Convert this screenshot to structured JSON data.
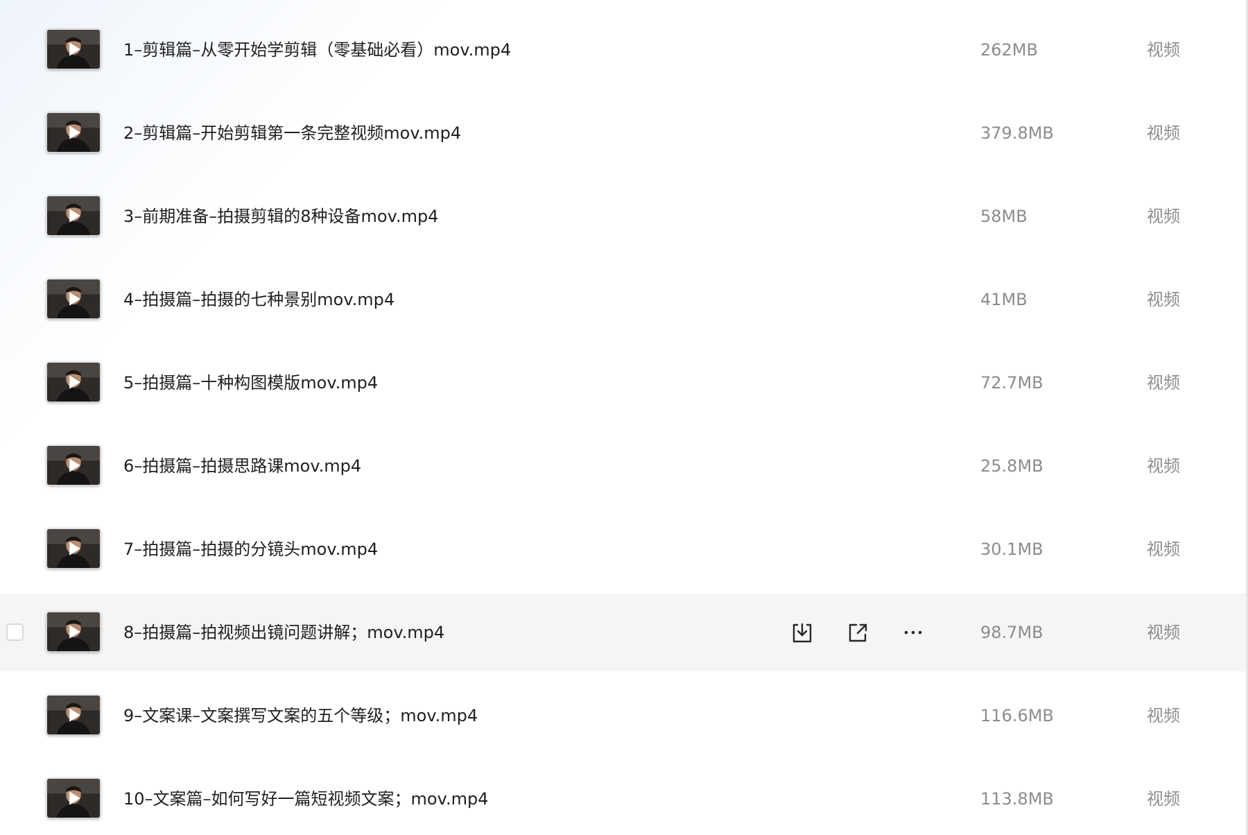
{
  "files": [
    {
      "name": "1–剪辑篇–从零开始学剪辑（零基础必看）mov.mp4",
      "size": "262MB",
      "type": "视频",
      "thumbnail": "video-thumbnail"
    },
    {
      "name": "2–剪辑篇–开始剪辑第一条完整视频mov.mp4",
      "size": "379.8MB",
      "type": "视频",
      "thumbnail": "video-thumbnail"
    },
    {
      "name": "3–前期准备–拍摄剪辑的8种设备mov.mp4",
      "size": "58MB",
      "type": "视频",
      "thumbnail": "video-thumbnail"
    },
    {
      "name": "4–拍摄篇–拍摄的七种景别mov.mp4",
      "size": "41MB",
      "type": "视频",
      "thumbnail": "video-thumbnail"
    },
    {
      "name": "5–拍摄篇–十种构图模版mov.mp4",
      "size": "72.7MB",
      "type": "视频",
      "thumbnail": "video-thumbnail"
    },
    {
      "name": "6–拍摄篇–拍摄思路课mov.mp4",
      "size": "25.8MB",
      "type": "视频",
      "thumbnail": "video-thumbnail"
    },
    {
      "name": "7–拍摄篇–拍摄的分镜头mov.mp4",
      "size": "30.1MB",
      "type": "视频",
      "thumbnail": "video-thumbnail"
    },
    {
      "name": "8–拍摄篇–拍视频出镜问题讲解；mov.mp4",
      "size": "98.7MB",
      "type": "视频",
      "thumbnail": "video-thumbnail",
      "hovered": true
    },
    {
      "name": "9–文案课–文案撰写文案的五个等级；mov.mp4",
      "size": "116.6MB",
      "type": "视频",
      "thumbnail": "video-thumbnail"
    },
    {
      "name": "10–文案篇–如何写好一篇短视频文案；mov.mp4",
      "size": "113.8MB",
      "type": "视频",
      "thumbnail": "video-thumbnail"
    }
  ],
  "hover_actions": [
    "download-icon",
    "share-icon",
    "more-icon"
  ],
  "colors": {
    "hover_row_bg": "#f5f5f5",
    "name_text": "#1f1f1f",
    "meta_text": "#8c8c8c",
    "icon_stroke": "#262626"
  }
}
